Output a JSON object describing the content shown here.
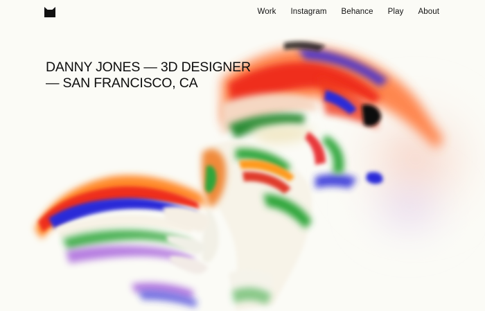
{
  "brand": {
    "logo_icon": "cat-head-logo-icon"
  },
  "nav": {
    "items": [
      {
        "label": "Work"
      },
      {
        "label": "Instagram"
      },
      {
        "label": "Behance"
      },
      {
        "label": "Play"
      },
      {
        "label": "About"
      }
    ]
  },
  "hero": {
    "line1": "DANNY JONES — 3D DESIGNER",
    "line2": "— SAN FRANCISCO, CA"
  },
  "colors": {
    "background": "#fbfbf6",
    "text": "#111111",
    "art_red": "#f0391c",
    "art_orange": "#ff8a2a",
    "art_blue": "#2b2bd8",
    "art_green": "#2fa63a",
    "art_purple": "#8a4fd8"
  }
}
